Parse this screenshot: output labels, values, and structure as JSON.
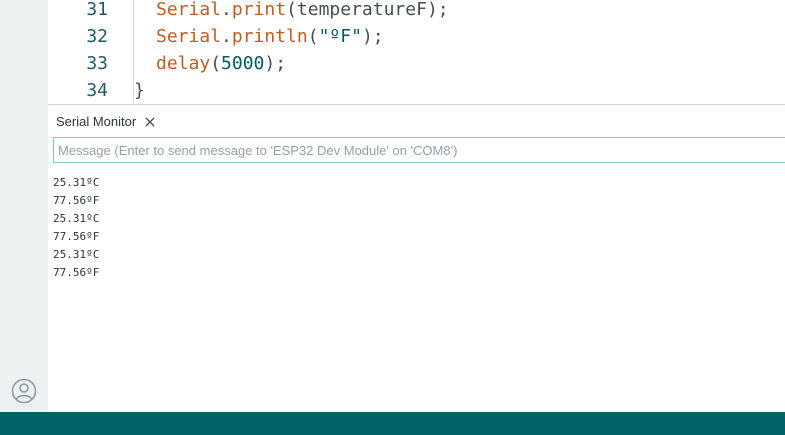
{
  "editor": {
    "lines": [
      {
        "num": "31",
        "tokens": [
          {
            "t": "Serial",
            "c": "obj"
          },
          {
            "t": ".",
            "c": "plain"
          },
          {
            "t": "print",
            "c": "fn"
          },
          {
            "t": "(temperatureF);",
            "c": "plain"
          }
        ]
      },
      {
        "num": "32",
        "tokens": [
          {
            "t": "Serial",
            "c": "obj"
          },
          {
            "t": ".",
            "c": "plain"
          },
          {
            "t": "println",
            "c": "fn"
          },
          {
            "t": "(",
            "c": "plain"
          },
          {
            "t": "\"ºF\"",
            "c": "str"
          },
          {
            "t": ");",
            "c": "plain"
          }
        ]
      },
      {
        "num": "33",
        "tokens": [
          {
            "t": "delay",
            "c": "fn"
          },
          {
            "t": "(",
            "c": "plain"
          },
          {
            "t": "5000",
            "c": "num"
          },
          {
            "t": ");",
            "c": "plain"
          }
        ]
      },
      {
        "num": "34",
        "tokens": [
          {
            "t": "}",
            "c": "plain"
          }
        ]
      }
    ]
  },
  "serial_monitor": {
    "tab_label": "Serial Monitor",
    "input_placeholder": "Message (Enter to send message to 'ESP32 Dev Module' on 'COM8')",
    "output": [
      "25.31ºC",
      "77.56ºF",
      "25.31ºC",
      "77.56ºF",
      "25.31ºC",
      "77.56ºF"
    ]
  },
  "icons": {
    "account": "account-icon",
    "close": "close-icon"
  },
  "colors": {
    "accent": "#006468",
    "rail": "#ecf1f1",
    "keyword": "#c65b1c",
    "literal": "#005c5f"
  }
}
